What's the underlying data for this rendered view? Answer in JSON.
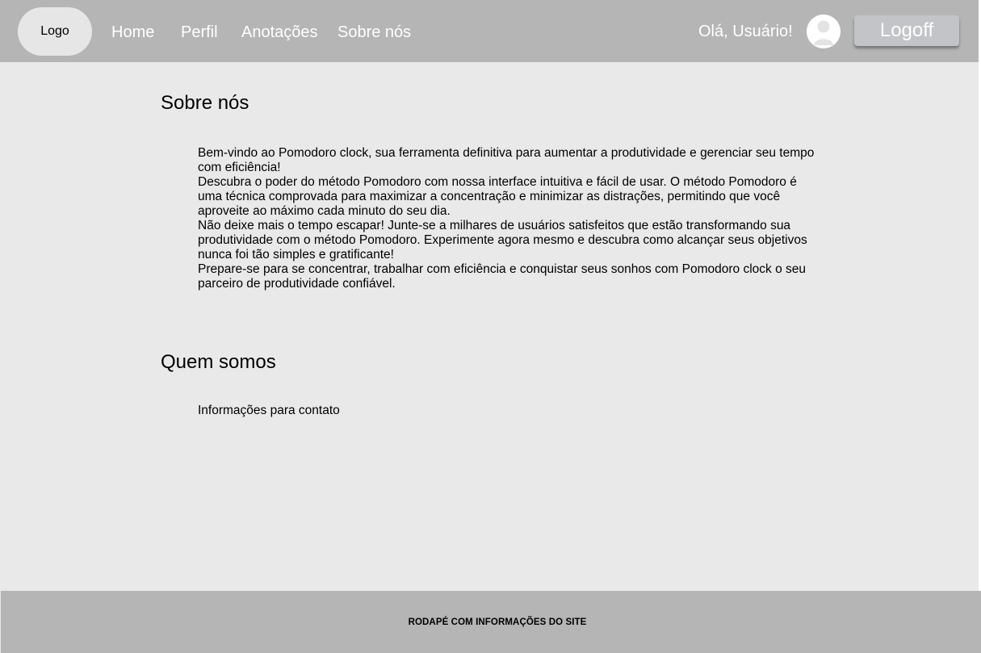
{
  "header": {
    "logo": "Logo",
    "nav": [
      "Home",
      "Perfil",
      "Anotações",
      "Sobre nós"
    ],
    "greeting": "Olá, Usuário!",
    "avatar_icon": "user-avatar-icon",
    "logoff_label": "Logoff"
  },
  "main": {
    "about": {
      "title": "Sobre nós",
      "paragraphs": [
        "Bem-vindo ao Pomodoro clock, sua ferramenta definitiva para aumentar a produtividade e gerenciar seu tempo com eficiência!",
        "Descubra o poder do método Pomodoro com nossa interface intuitiva e fácil de usar. O método Pomodoro é uma técnica comprovada para maximizar a concentração e minimizar as distrações, permitindo que você aproveite ao máximo cada minuto do seu dia.",
        "Não deixe mais o tempo escapar! Junte-se a milhares de usuários satisfeitos que estão transformando sua produtividade com o método Pomodoro. Experimente agora mesmo e descubra como alcançar seus objetivos nunca foi tão simples e gratificante!",
        "Prepare-se para se concentrar, trabalhar com eficiência e conquistar seus sonhos com Pomodoro clock o seu parceiro de produtividade confiável."
      ]
    },
    "who": {
      "title": "Quem somos",
      "contact": "Informações para contato"
    }
  },
  "footer": {
    "text": "RODAPÉ COM INFORMAÇÕES DO SITE"
  },
  "colors": {
    "header_bg": "#b5b5b5",
    "page_bg": "#e9e9e9",
    "button_bg": "#c2c4c7"
  }
}
